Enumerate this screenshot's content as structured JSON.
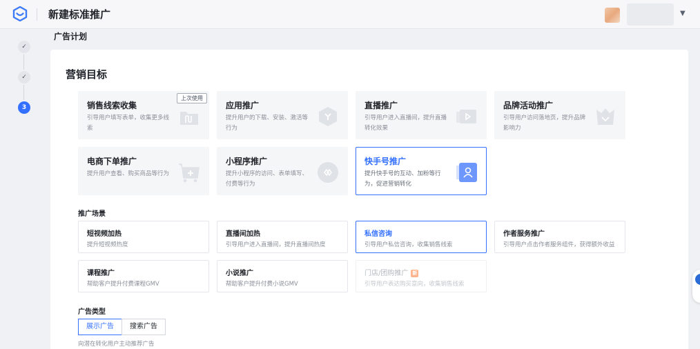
{
  "topbar": {
    "logo_icon": "brand-logo-icon",
    "title": "新建标准推广",
    "avatar_icon": "user-avatar-icon",
    "dropdown_icon": "caret-down-icon"
  },
  "plan_label": "广告计划",
  "steps": [
    {
      "label": "✓",
      "status": "done"
    },
    {
      "label": "✓",
      "status": "done"
    },
    {
      "label": "3",
      "status": "active"
    }
  ],
  "marketing_goal": {
    "title": "营销目标",
    "cards": [
      {
        "title": "销售线索收集",
        "desc": "引导用户填写表单，收集更多线索",
        "tag": "上次使用",
        "icon": "folder-icon",
        "selected": false
      },
      {
        "title": "应用推广",
        "desc": "提升用户的下载、安装、激活等行为",
        "icon": "app-cube-icon",
        "selected": false
      },
      {
        "title": "直播推广",
        "desc": "引导用户进入直播间，提升直播转化效果",
        "icon": "live-video-icon",
        "selected": false
      },
      {
        "title": "品牌活动推广",
        "desc": "引导用户访问落地页，提升品牌影响力",
        "icon": "crown-icon",
        "selected": false
      },
      {
        "title": "电商下单推广",
        "desc": "提升用户查看、购买商品等行为",
        "icon": "cart-icon",
        "selected": false
      },
      {
        "title": "小程序推广",
        "desc": "提升小程序的访问、表单填写、付费等行为",
        "icon": "mini-program-icon",
        "selected": false
      },
      {
        "title": "快手号推广",
        "desc": "提升快手号的互动、加粉等行为，促进营销转化",
        "icon": "profile-card-icon",
        "selected": true
      }
    ]
  },
  "scenes": {
    "title": "推广场景",
    "cards": [
      {
        "title": "短视频加热",
        "desc": "提升短视频热度",
        "selected": false,
        "disabled": false
      },
      {
        "title": "直播间加热",
        "desc": "引导用户进入直播间，提升直播间热度",
        "selected": false,
        "disabled": false
      },
      {
        "title": "私信咨询",
        "desc": "引导用户私信咨询，收集销售线索",
        "selected": true,
        "disabled": false
      },
      {
        "title": "作者服务推广",
        "desc": "引导用户点击作者服务组件，获得额外收益",
        "selected": false,
        "disabled": false
      },
      {
        "title": "课程推广",
        "desc": "帮助客户提升付费课程GMV",
        "selected": false,
        "disabled": false
      },
      {
        "title": "小说推广",
        "desc": "帮助客户提升付费小说GMV",
        "selected": false,
        "disabled": false
      },
      {
        "title": "门店/团购推广",
        "desc": "引导用户表达购买意向，收集销售线索",
        "selected": false,
        "disabled": true,
        "badge": "新"
      }
    ]
  },
  "ad_type": {
    "title": "广告类型",
    "options": [
      {
        "label": "展示广告",
        "active": true
      },
      {
        "label": "搜索广告",
        "active": false
      }
    ],
    "hint": "向潜在转化用户主动推荐广告"
  },
  "colors": {
    "accent": "#3370ff",
    "page_bg": "#f0f1f5",
    "card_bg": "#f5f6f8"
  }
}
